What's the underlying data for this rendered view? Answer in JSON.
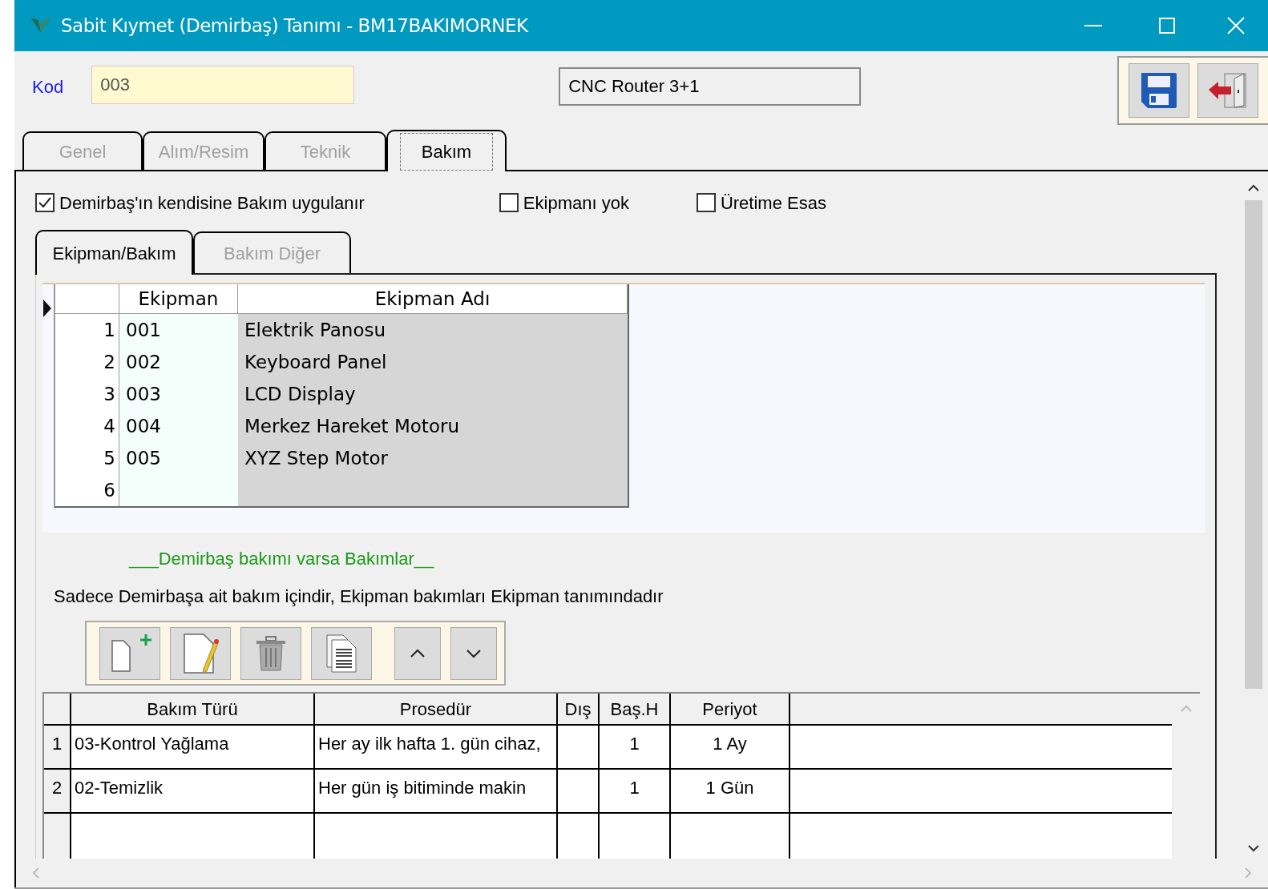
{
  "window": {
    "title": "Sabit Kıymet (Demirbaş) Tanımı - BM17BAKIMORNEK"
  },
  "header": {
    "kod_label": "Kod",
    "kod_value": "003",
    "name_value": "CNC Router 3+1"
  },
  "tabs": [
    {
      "label": "Genel",
      "selected": false
    },
    {
      "label": "Alım/Resim",
      "selected": false
    },
    {
      "label": "Teknik",
      "selected": false
    },
    {
      "label": "Bakım",
      "selected": true
    }
  ],
  "options": [
    {
      "label": "Demirbaş'ın kendisine Bakım uygulanır",
      "checked": true
    },
    {
      "label": "Ekipmanı yok",
      "checked": false
    },
    {
      "label": "Üretime Esas",
      "checked": false
    }
  ],
  "sub_tabs": [
    {
      "label": "Ekipman/Bakım",
      "selected": true
    },
    {
      "label": "Bakım Diğer",
      "selected": false
    }
  ],
  "equipment_table": {
    "columns": [
      "Ekipman",
      "Ekipman Adı"
    ],
    "rows": [
      {
        "number": "1",
        "code": "001",
        "name": "Elektrik Panosu"
      },
      {
        "number": "2",
        "code": "002",
        "name": "Keyboard Panel"
      },
      {
        "number": "3",
        "code": "003",
        "name": "LCD Display"
      },
      {
        "number": "4",
        "code": "004",
        "name": "Merkez Hareket Motoru"
      },
      {
        "number": "5",
        "code": "005",
        "name": "XYZ Step Motor"
      },
      {
        "number": "6"
      }
    ]
  },
  "maintenance_heading": "___Demirbaş bakımı varsa Bakımlar__",
  "note": "Sadece Demirbaşa ait bakım içindir, Ekipman bakımları Ekipman tanımındadır",
  "maintenance_table": {
    "columns": [
      "Bakım Türü",
      "Prosedür",
      "Dış",
      "Baş.H",
      "Periyot"
    ],
    "rows": [
      {
        "number": "1",
        "type": "03-Kontrol Yağlama",
        "procedure": "Her ay ilk hafta 1. gün cihaz,",
        "start": "1",
        "period": "1 Ay"
      },
      {
        "number": "2",
        "type": "02-Temizlik",
        "procedure": "Her gün iş bitiminde makin",
        "start": "1",
        "period": "1 Gün"
      }
    ]
  }
}
